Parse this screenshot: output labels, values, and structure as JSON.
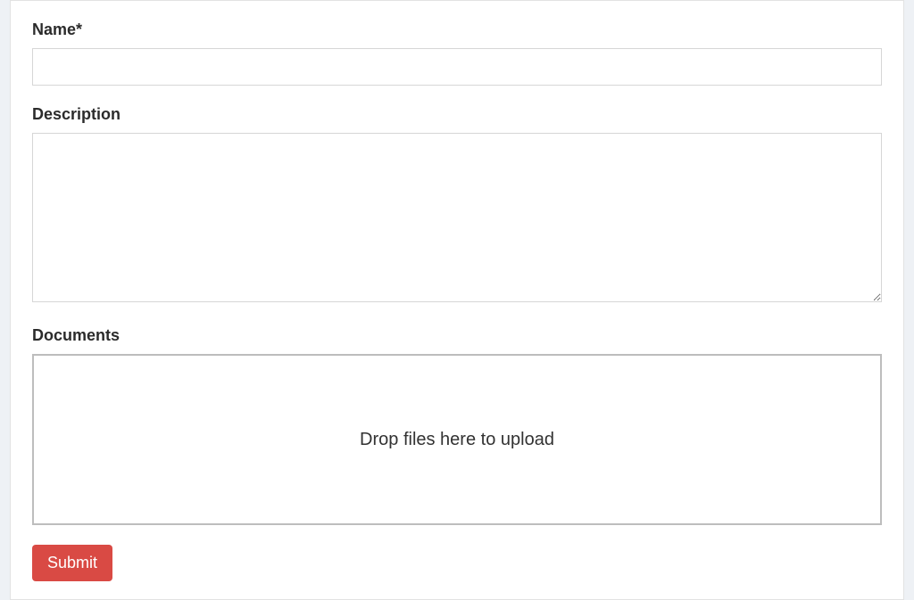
{
  "form": {
    "fields": {
      "name": {
        "label": "Name*",
        "value": ""
      },
      "description": {
        "label": "Description",
        "value": ""
      },
      "documents": {
        "label": "Documents",
        "dropzone_text": "Drop files here to upload"
      }
    },
    "submit_label": "Submit"
  }
}
